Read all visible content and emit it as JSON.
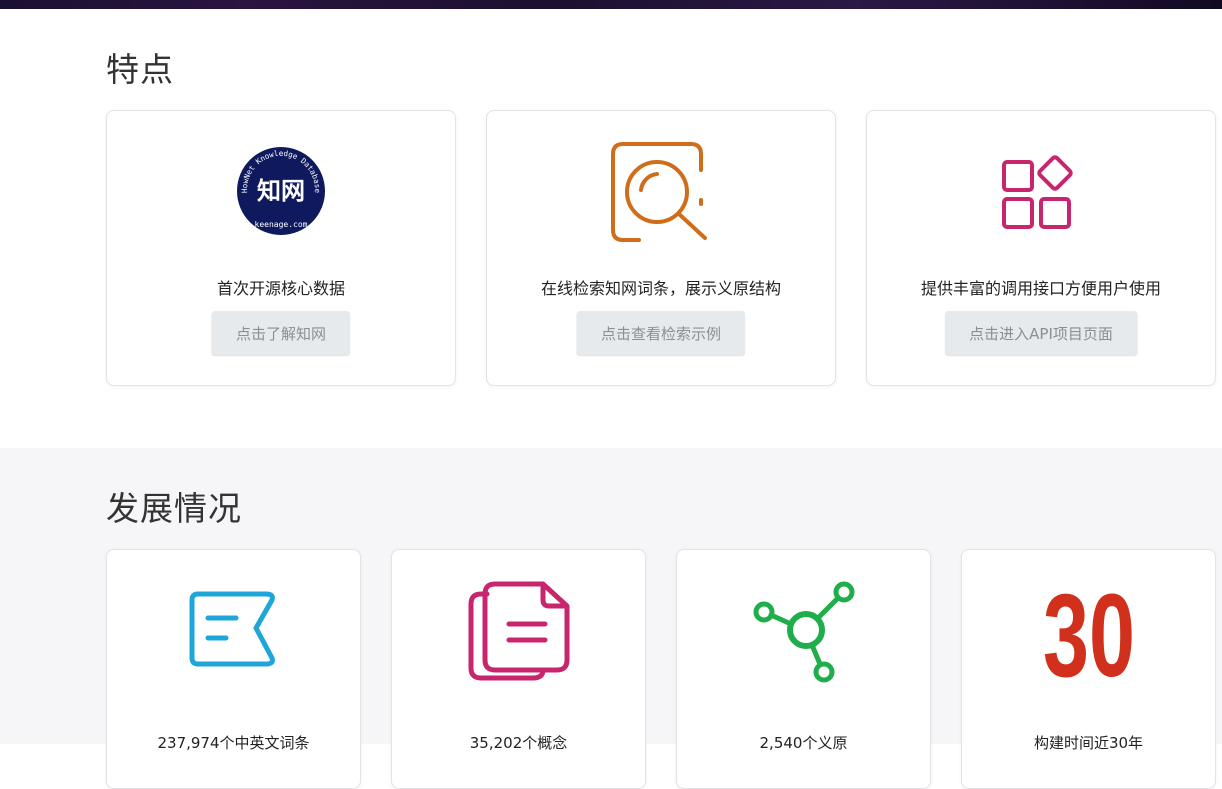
{
  "features": {
    "title": "特点",
    "cards": [
      {
        "icon": "zhiwang-logo-icon",
        "logo_text": {
          "main": "知网",
          "ring_top": "HowNet Knowledge Database",
          "ring_bottom": "keenage.com"
        },
        "description": "首次开源核心数据",
        "button": "点击了解知网"
      },
      {
        "icon": "search-magnifier-icon",
        "description": "在线检索知网词条，展示义原结构",
        "button": "点击查看检索示例"
      },
      {
        "icon": "apps-grid-icon",
        "description": "提供丰富的调用接口方便用户使用",
        "button": "点击进入API项目页面"
      }
    ]
  },
  "progress": {
    "title": "发展情况",
    "stats": [
      {
        "icon": "entry-tag-icon",
        "color": "#1ea6db",
        "description": "237,974个中英文词条"
      },
      {
        "icon": "documents-icon",
        "color": "#c8256f",
        "description": "35,202个概念"
      },
      {
        "icon": "network-nodes-icon",
        "color": "#1fae4a",
        "description": "2,540个义原"
      },
      {
        "icon": "number-30-icon",
        "color": "#d0301c",
        "big_number": "30",
        "description": "构建时间近30年"
      }
    ]
  },
  "colors": {
    "search_icon": "#cf6d1a",
    "apps_icon": "#c8256f",
    "logo_bg": "#0f1a5e",
    "button_bg": "#e6eaed",
    "button_text": "#8a8f94"
  }
}
